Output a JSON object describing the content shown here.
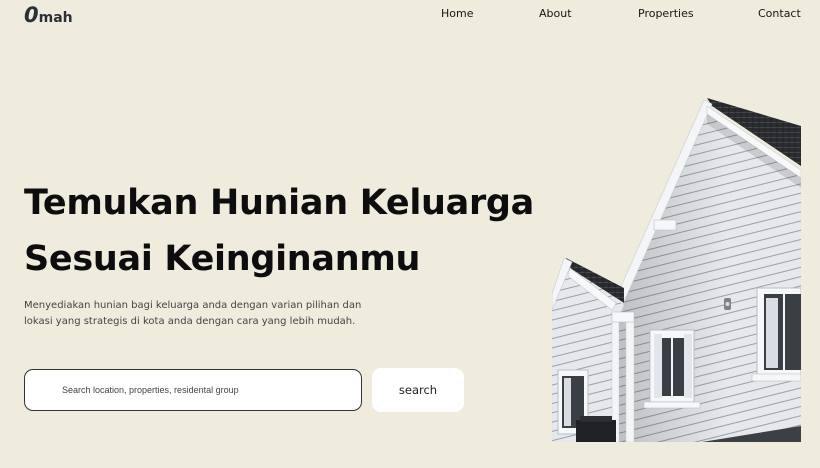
{
  "brand": {
    "logo_o": "0",
    "logo_rest": "mah"
  },
  "nav": {
    "home": "Home",
    "about": "About",
    "properties": "Properties",
    "contact": "Contact"
  },
  "hero": {
    "title_line1": "Temukan Hunian Keluarga",
    "title_line2": "Sesuai Keinginanmu",
    "subtitle_line1": "Menyediakan hunian bagi keluarga anda dengan varian pilihan dan",
    "subtitle_line2": "lokasi yang strategis di kota anda dengan cara yang lebih mudah."
  },
  "search": {
    "placeholder": "Search location, properties, residental group",
    "button_label": "search"
  },
  "colors": {
    "background": "#efebdd",
    "text": "#0d0d0d",
    "card": "#ffffff"
  }
}
